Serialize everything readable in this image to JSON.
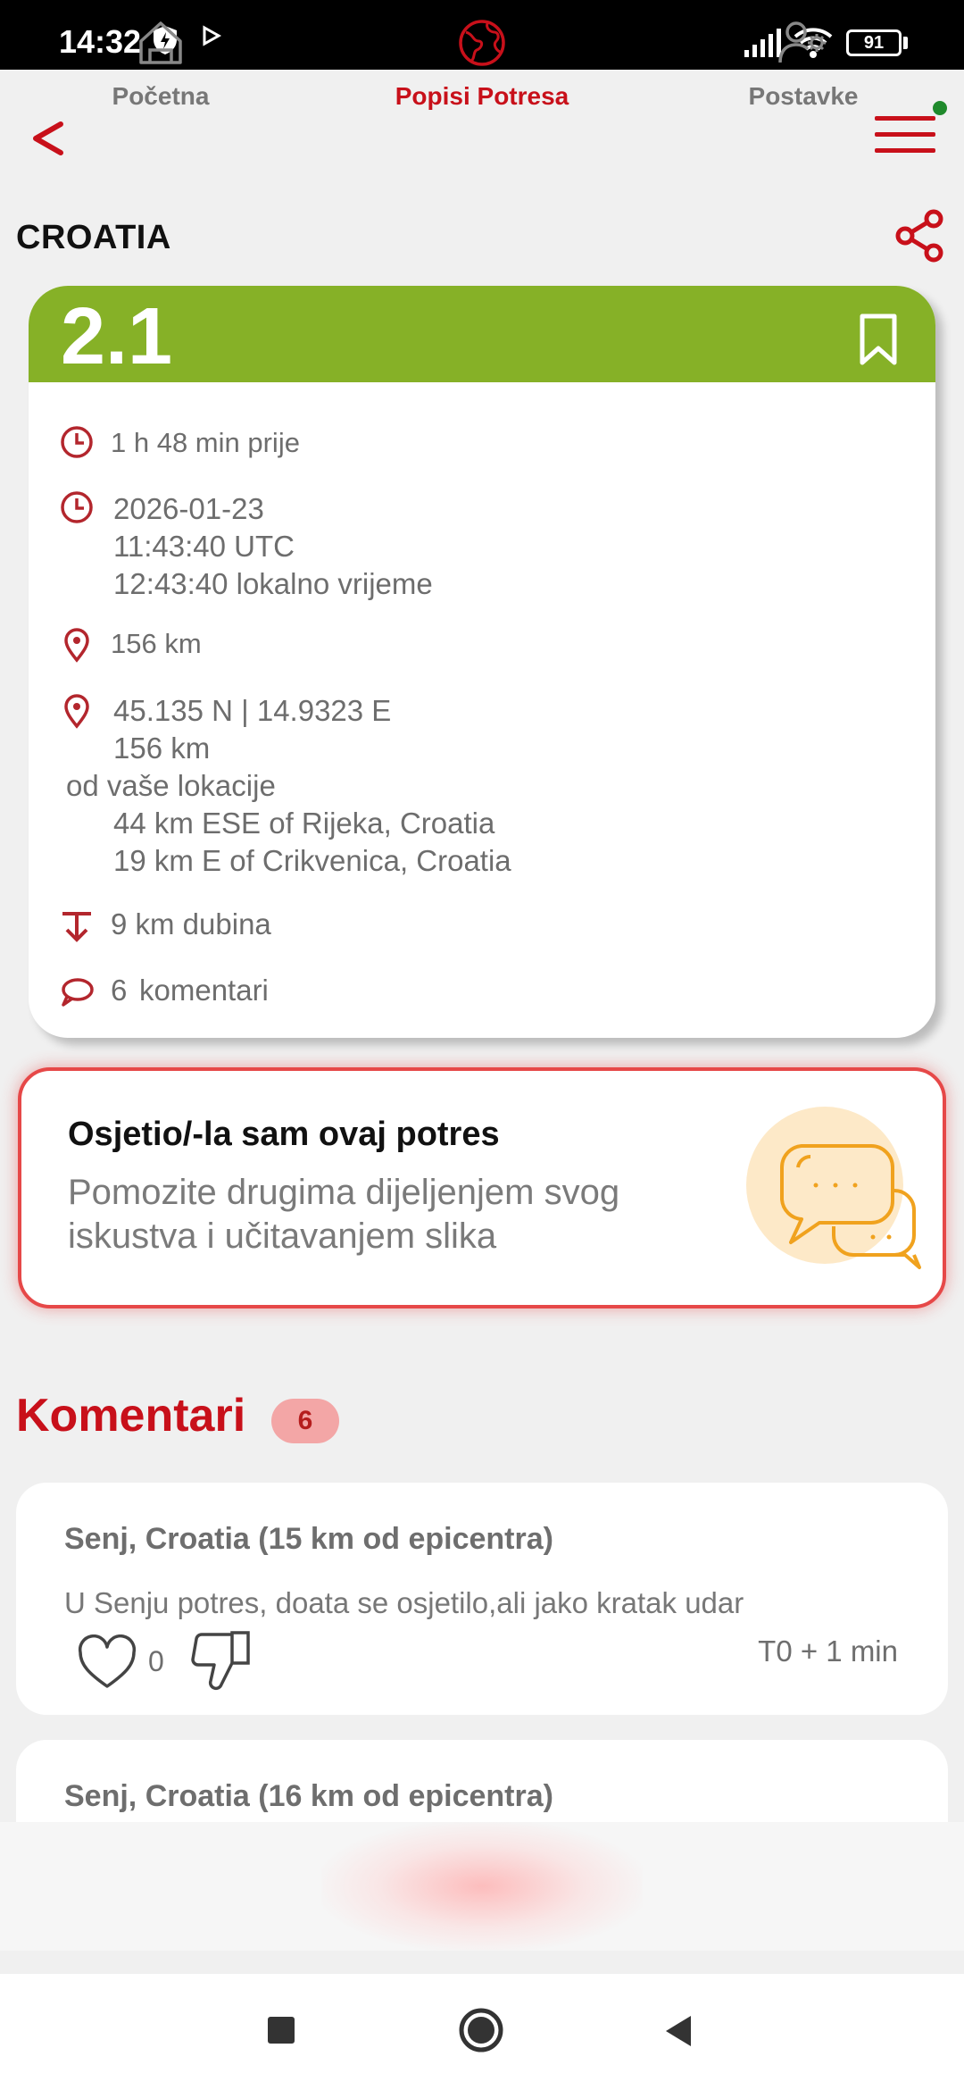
{
  "status_bar": {
    "time": "14:32",
    "battery": "91"
  },
  "header": {
    "country": "CROATIA"
  },
  "quake": {
    "magnitude": "2.1",
    "time_ago": "1 h 48 min prije",
    "date": "2026-01-23",
    "utc_time": "11:43:40 UTC",
    "local_time": "12:43:40 lokalno vrijeme",
    "distance": "156 km",
    "coords": "45.135 N | 14.9323 E",
    "coords_distance": "156 km",
    "from_location": "od vaše lokacije",
    "nearby_1": "44 km ESE of Rijeka, Croatia",
    "nearby_2": "19 km E of Crikvenica, Croatia",
    "depth": "9 km dubina",
    "comments_count": "6",
    "comments_label": "komentari"
  },
  "felt_card": {
    "title": "Osjetio/-la sam ovaj potres",
    "subtitle": "Pomozite drugima dijeljenjem svog iskustva i učitavanjem slika"
  },
  "comments": {
    "heading": "Komentari",
    "count": "6",
    "items": [
      {
        "location": "Senj, Croatia (15 km od epicentra)",
        "text": "U Senju potres, doata se osjetilo,ali jako kratak udar",
        "likes": "0",
        "time": "T0 + 1 min"
      },
      {
        "location": "Senj, Croatia (16 km od epicentra)"
      }
    ]
  },
  "bottom_nav": {
    "items": [
      {
        "label": "Početna",
        "icon": "home-icon"
      },
      {
        "label": "Popisi Potresa",
        "icon": "globe-icon",
        "active": true
      },
      {
        "label": "Postavke",
        "icon": "user-settings-icon"
      }
    ]
  },
  "colors": {
    "accent": "#c8101a",
    "magnitude_bg": "#86b127",
    "felt_border": "#e64848"
  }
}
